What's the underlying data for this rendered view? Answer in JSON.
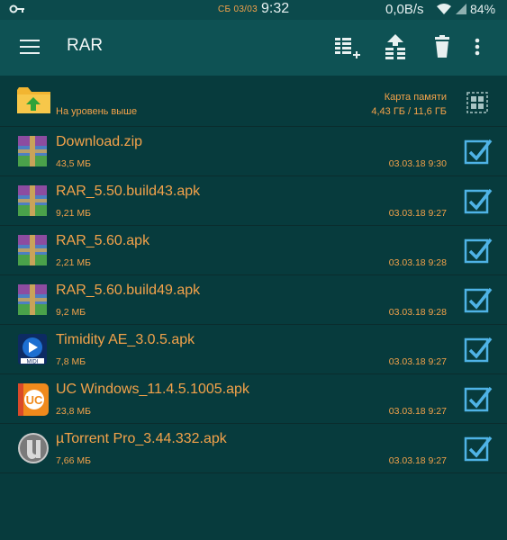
{
  "status_bar": {
    "date": "СБ 03/03",
    "time": "9:32",
    "speed": "0,0B/s",
    "battery": "84%"
  },
  "toolbar": {
    "title": "RAR",
    "icons": [
      "menu-icon",
      "add-to-archive-icon",
      "extract-icon",
      "delete-icon",
      "more-icon"
    ]
  },
  "up_row": {
    "label": "На уровень выше",
    "memory_label": "Карта памяти",
    "memory_value": "4,43 ГБ / 11,6 ГБ"
  },
  "files": [
    {
      "name": "Download.zip",
      "size": "43,5 МБ",
      "date": "03.03.18 9:30",
      "icon": "archive-icon",
      "checked": true
    },
    {
      "name": "RAR_5.50.build43.apk",
      "size": "9,21 МБ",
      "date": "03.03.18 9:27",
      "icon": "archive-icon",
      "checked": true
    },
    {
      "name": "RAR_5.60.apk",
      "size": "2,21 МБ",
      "date": "03.03.18 9:28",
      "icon": "archive-icon",
      "checked": true
    },
    {
      "name": "RAR_5.60.build49.apk",
      "size": "9,2 МБ",
      "date": "03.03.18 9:28",
      "icon": "archive-icon",
      "checked": true
    },
    {
      "name": "Timidity AE_3.0.5.apk",
      "size": "7,8 МБ",
      "date": "03.03.18 9:27",
      "icon": "midi-app-icon",
      "checked": true
    },
    {
      "name": "UC Windows_11.4.5.1005.apk",
      "size": "23,8 МБ",
      "date": "03.03.18 9:27",
      "icon": "uc-browser-icon",
      "checked": true
    },
    {
      "name": "µTorrent Pro_3.44.332.apk",
      "size": "7,66 МБ",
      "date": "03.03.18 9:27",
      "icon": "utorrent-icon",
      "checked": true
    }
  ],
  "colors": {
    "background": "#073b3d",
    "toolbar": "#0e5254",
    "accent_text": "#f3a24a",
    "check": "#4fb3e6"
  }
}
